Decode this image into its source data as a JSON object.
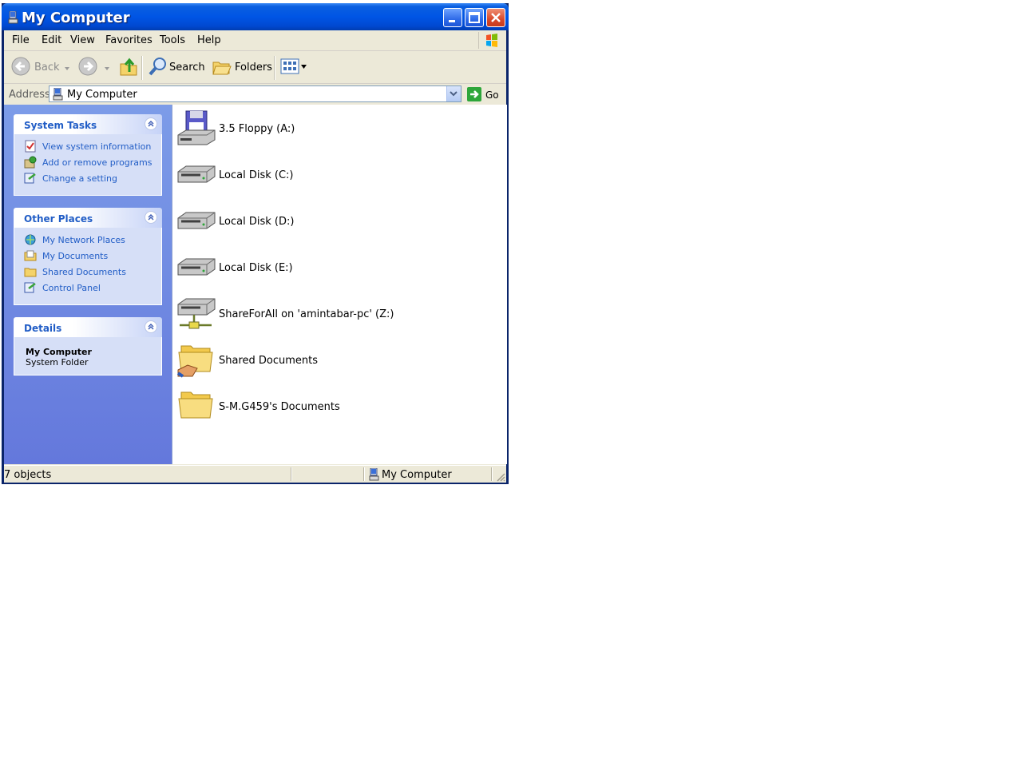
{
  "window": {
    "title": "My Computer"
  },
  "menu": [
    "File",
    "Edit",
    "View",
    "Favorites",
    "Tools",
    "Help"
  ],
  "toolbar": {
    "back": "Back",
    "search": "Search",
    "folders": "Folders"
  },
  "address": {
    "label": "Address",
    "value": "My Computer",
    "go": "Go"
  },
  "panels": {
    "system_tasks": {
      "title": "System Tasks",
      "items": [
        "View system information",
        "Add or remove programs",
        "Change a setting"
      ]
    },
    "other_places": {
      "title": "Other Places",
      "items": [
        "My Network Places",
        "My Documents",
        "Shared Documents",
        "Control Panel"
      ]
    },
    "details": {
      "title": "Details",
      "name": "My Computer",
      "type": "System Folder"
    }
  },
  "items": [
    {
      "label": "3.5 Floppy (A:)",
      "icon": "floppy-drive-icon"
    },
    {
      "label": "Local Disk (C:)",
      "icon": "hard-disk-icon"
    },
    {
      "label": "Local Disk (D:)",
      "icon": "hard-disk-icon"
    },
    {
      "label": "Local Disk (E:)",
      "icon": "hard-disk-icon"
    },
    {
      "label": "ShareForAll on 'amintabar-pc' (Z:)",
      "icon": "network-drive-icon"
    },
    {
      "label": "Shared Documents",
      "icon": "shared-folder-icon"
    },
    {
      "label": "S-M.G459's Documents",
      "icon": "folder-icon"
    }
  ],
  "status": {
    "count": "7 objects",
    "location": "My Computer"
  },
  "colors": {
    "titlebar": "#0055e5",
    "sidebar": "#6f88e0",
    "link": "#215dc6",
    "chrome": "#ece9d8"
  }
}
